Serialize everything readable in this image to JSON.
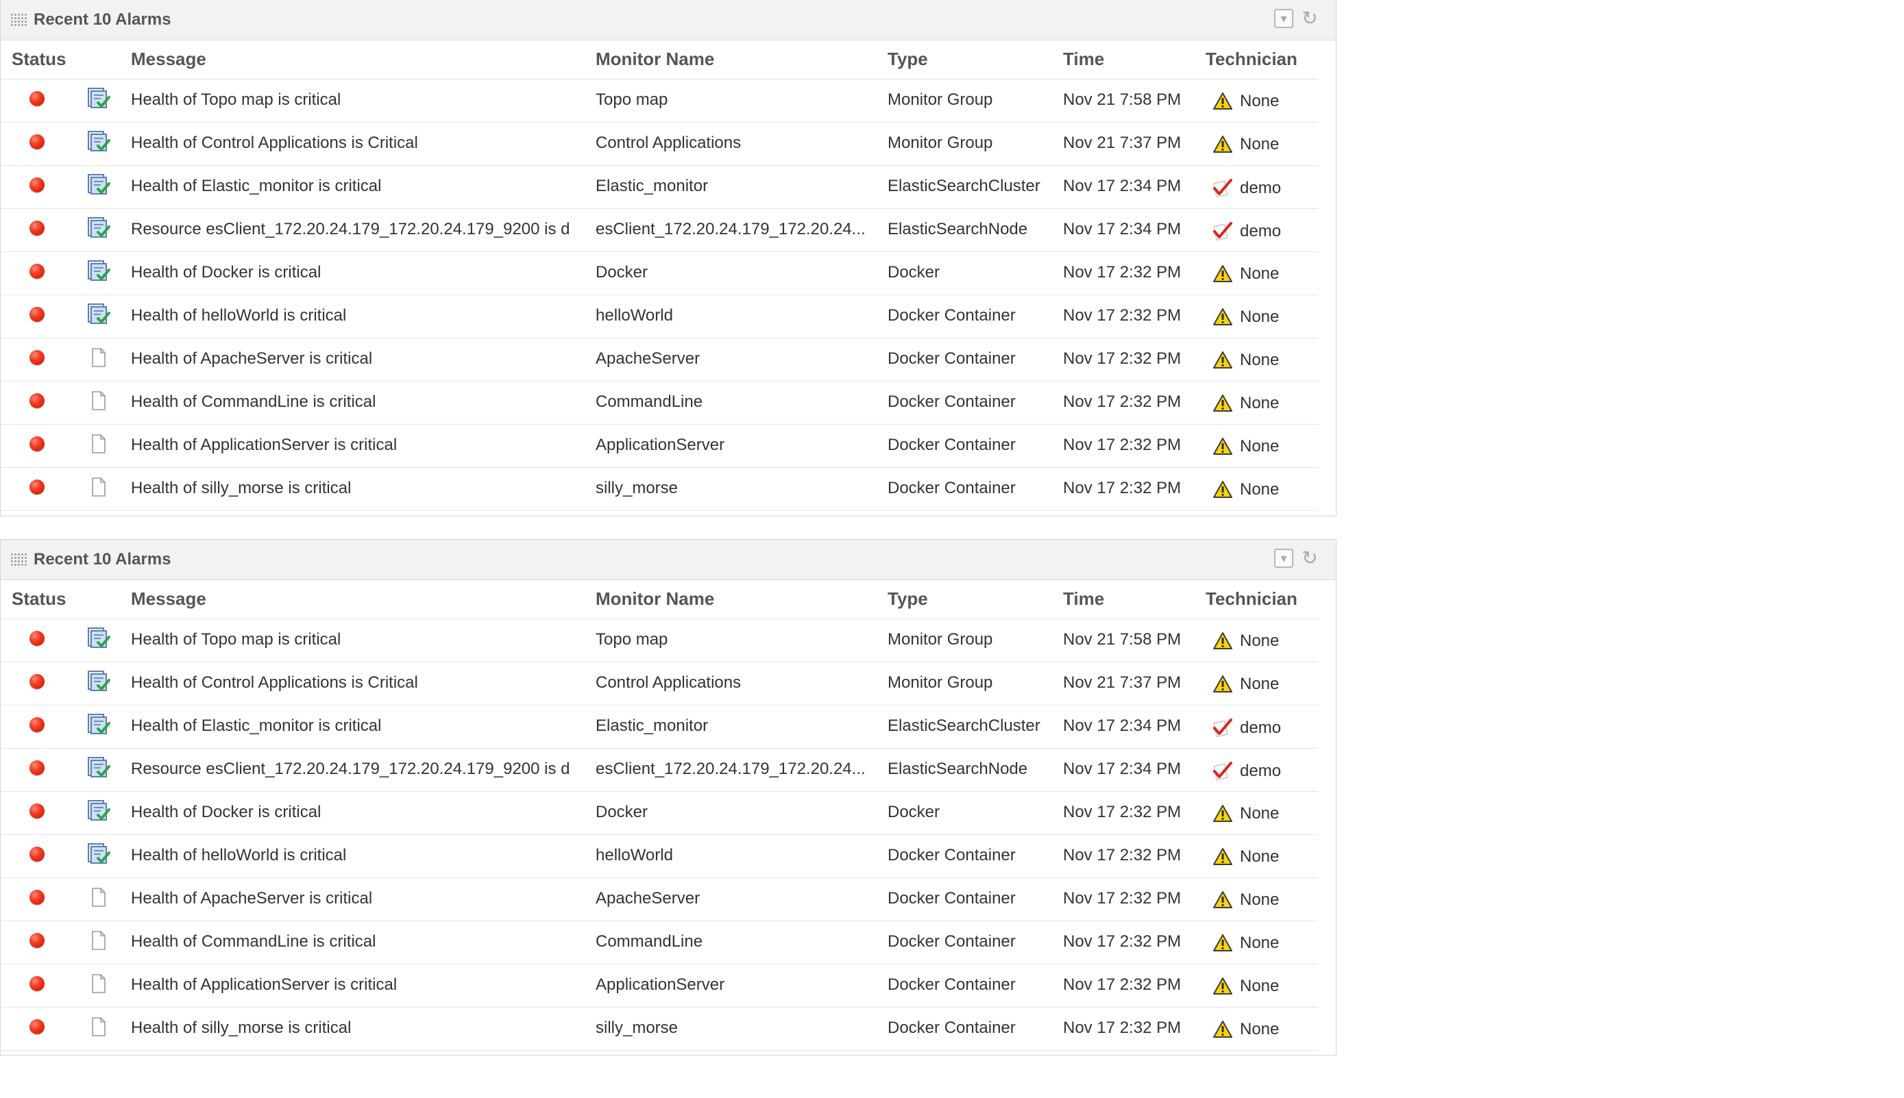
{
  "widgets": [
    {
      "title": "Recent 10 Alarms",
      "columns": [
        "Status",
        "Message",
        "Monitor Name",
        "Type",
        "Time",
        "Technician"
      ],
      "rows": [
        {
          "message": "Health of Topo map is critical",
          "monitor": "Topo map",
          "type": "Monitor Group",
          "time": "Nov 21 7:58 PM",
          "technician": "None",
          "tech_icon": "warning-icon",
          "row_icon": "monitor-doc-icon"
        },
        {
          "message": "Health of Control Applications is Critical",
          "monitor": "Control Applications",
          "type": "Monitor Group",
          "time": "Nov 21 7:37 PM",
          "technician": "None",
          "tech_icon": "warning-icon",
          "row_icon": "monitor-doc-icon"
        },
        {
          "message": "Health of Elastic_monitor is critical",
          "monitor": "Elastic_monitor",
          "type": "ElasticSearchCluster",
          "time": "Nov 17 2:34 PM",
          "technician": "demo",
          "tech_icon": "acknowledged-icon",
          "row_icon": "monitor-doc-icon"
        },
        {
          "message": "Resource esClient_172.20.24.179_172.20.24.179_9200 is d",
          "monitor": "esClient_172.20.24.179_172.20.24...",
          "type": "ElasticSearchNode",
          "time": "Nov 17 2:34 PM",
          "technician": "demo",
          "tech_icon": "acknowledged-icon",
          "row_icon": "monitor-doc-icon"
        },
        {
          "message": "Health of Docker is critical",
          "monitor": "Docker",
          "type": "Docker",
          "time": "Nov 17 2:32 PM",
          "technician": "None",
          "tech_icon": "warning-icon",
          "row_icon": "monitor-doc-icon"
        },
        {
          "message": "Health of helloWorld is critical",
          "monitor": "helloWorld",
          "type": "Docker Container",
          "time": "Nov 17 2:32 PM",
          "technician": "None",
          "tech_icon": "warning-icon",
          "row_icon": "monitor-doc-icon"
        },
        {
          "message": "Health of ApacheServer is critical",
          "monitor": "ApacheServer",
          "type": "Docker Container",
          "time": "Nov 17 2:32 PM",
          "technician": "None",
          "tech_icon": "warning-icon",
          "row_icon": "blank-doc-icon"
        },
        {
          "message": "Health of CommandLine is critical",
          "monitor": "CommandLine",
          "type": "Docker Container",
          "time": "Nov 17 2:32 PM",
          "technician": "None",
          "tech_icon": "warning-icon",
          "row_icon": "blank-doc-icon"
        },
        {
          "message": "Health of ApplicationServer is critical",
          "monitor": "ApplicationServer",
          "type": "Docker Container",
          "time": "Nov 17 2:32 PM",
          "technician": "None",
          "tech_icon": "warning-icon",
          "row_icon": "blank-doc-icon"
        },
        {
          "message": "Health of silly_morse is critical",
          "monitor": "silly_morse",
          "type": "Docker Container",
          "time": "Nov 17 2:32 PM",
          "technician": "None",
          "tech_icon": "warning-icon",
          "row_icon": "blank-doc-icon"
        }
      ]
    },
    {
      "title": "Recent 10 Alarms",
      "columns": [
        "Status",
        "Message",
        "Monitor Name",
        "Type",
        "Time",
        "Technician"
      ],
      "rows": [
        {
          "message": "Health of Topo map is critical",
          "monitor": "Topo map",
          "type": "Monitor Group",
          "time": "Nov 21 7:58 PM",
          "technician": "None",
          "tech_icon": "warning-icon",
          "row_icon": "monitor-doc-icon"
        },
        {
          "message": "Health of Control Applications is Critical",
          "monitor": "Control Applications",
          "type": "Monitor Group",
          "time": "Nov 21 7:37 PM",
          "technician": "None",
          "tech_icon": "warning-icon",
          "row_icon": "monitor-doc-icon"
        },
        {
          "message": "Health of Elastic_monitor is critical",
          "monitor": "Elastic_monitor",
          "type": "ElasticSearchCluster",
          "time": "Nov 17 2:34 PM",
          "technician": "demo",
          "tech_icon": "acknowledged-icon",
          "row_icon": "monitor-doc-icon"
        },
        {
          "message": "Resource esClient_172.20.24.179_172.20.24.179_9200 is d",
          "monitor": "esClient_172.20.24.179_172.20.24...",
          "type": "ElasticSearchNode",
          "time": "Nov 17 2:34 PM",
          "technician": "demo",
          "tech_icon": "acknowledged-icon",
          "row_icon": "monitor-doc-icon"
        },
        {
          "message": "Health of Docker is critical",
          "monitor": "Docker",
          "type": "Docker",
          "time": "Nov 17 2:32 PM",
          "technician": "None",
          "tech_icon": "warning-icon",
          "row_icon": "monitor-doc-icon"
        },
        {
          "message": "Health of helloWorld is critical",
          "monitor": "helloWorld",
          "type": "Docker Container",
          "time": "Nov 17 2:32 PM",
          "technician": "None",
          "tech_icon": "warning-icon",
          "row_icon": "monitor-doc-icon"
        },
        {
          "message": "Health of ApacheServer is critical",
          "monitor": "ApacheServer",
          "type": "Docker Container",
          "time": "Nov 17 2:32 PM",
          "technician": "None",
          "tech_icon": "warning-icon",
          "row_icon": "blank-doc-icon"
        },
        {
          "message": "Health of CommandLine is critical",
          "monitor": "CommandLine",
          "type": "Docker Container",
          "time": "Nov 17 2:32 PM",
          "technician": "None",
          "tech_icon": "warning-icon",
          "row_icon": "blank-doc-icon"
        },
        {
          "message": "Health of ApplicationServer is critical",
          "monitor": "ApplicationServer",
          "type": "Docker Container",
          "time": "Nov 17 2:32 PM",
          "technician": "None",
          "tech_icon": "warning-icon",
          "row_icon": "blank-doc-icon"
        },
        {
          "message": "Health of silly_morse is critical",
          "monitor": "silly_morse",
          "type": "Docker Container",
          "time": "Nov 17 2:32 PM",
          "technician": "None",
          "tech_icon": "warning-icon",
          "row_icon": "blank-doc-icon"
        }
      ]
    }
  ],
  "colors": {
    "critical": "#e8230f",
    "header_bg": "#f2f2f2",
    "border": "#d6d6d6",
    "warning": "#f5d000",
    "ack_red": "#d9261c"
  }
}
